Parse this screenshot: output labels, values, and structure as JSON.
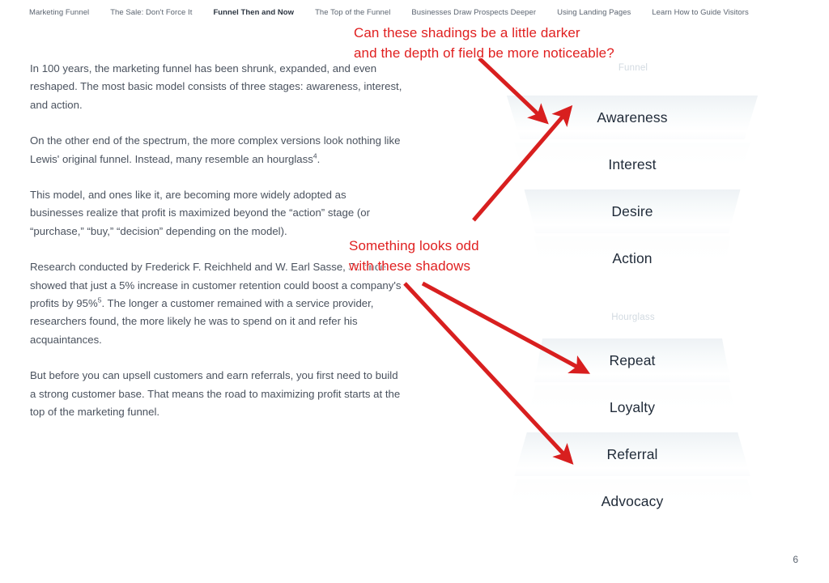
{
  "topnav": {
    "items": [
      {
        "label": "Marketing Funnel",
        "active": false
      },
      {
        "label": "The Sale: Don't Force It",
        "active": false
      },
      {
        "label": "Funnel Then and Now",
        "active": true
      },
      {
        "label": "The Top of the Funnel",
        "active": false
      },
      {
        "label": "Businesses Draw Prospects Deeper",
        "active": false
      },
      {
        "label": "Using Landing Pages",
        "active": false
      },
      {
        "label": "Learn How to Guide Visitors",
        "active": false
      }
    ]
  },
  "article": {
    "paragraphs": [
      "In 100 years, the marketing funnel has been shrunk, expanded, and even reshaped. The most basic model consists of three stages: awareness, interest, and action.",
      "On the other end of the spectrum, the more complex versions look nothing like Lewis' original funnel. Instead, many resemble an hourglass",
      "This model, and ones like it, are becoming more widely adopted as businesses realize that profit is maximized beyond the “action” stage (or “purchase,” “buy,” “decision” depending on the model).",
      "Research conducted by Frederick F. Reichheld and W. Earl Sasse, Jr. once showed that just a 5% increase in customer retention could boost a company's profits by 95%",
      "But before you can upsell customers and earn referrals, you first need to build a strong customer base. That means the road to maximizing profit starts at the top of the marketing funnel."
    ],
    "footnote_marks": {
      "hourglass": "4",
      "profits": "5"
    },
    "paragraph_tails": {
      "hourglass": ".",
      "profits": ". The longer a customer remained with a service provider, researchers found, the more likely he was to spend on it and refer his acquaintances."
    }
  },
  "diagram": {
    "funnel": {
      "label": "Funnel",
      "stages": [
        {
          "label": "Awareness",
          "tone": "shaded"
        },
        {
          "label": "Interest",
          "tone": "light"
        },
        {
          "label": "Desire",
          "tone": "shaded"
        },
        {
          "label": "Action",
          "tone": "light"
        }
      ]
    },
    "hourglass": {
      "label": "Hourglass",
      "stages": [
        {
          "label": "Repeat",
          "tone": "shaded"
        },
        {
          "label": "Loyalty",
          "tone": "light"
        },
        {
          "label": "Referral",
          "tone": "shaded"
        },
        {
          "label": "Advocacy",
          "tone": "light"
        }
      ]
    }
  },
  "annotations": [
    {
      "id": "shadings",
      "text": "Can these shadings be a little darker\nand the depth of field be more noticeable?"
    },
    {
      "id": "shadows",
      "text": "Something looks odd\nwith these shadows"
    }
  ],
  "page_number": "6",
  "colors": {
    "annotation_red": "#e02020",
    "body_text": "#4a525e",
    "stage_text": "#1f2a38",
    "group_label": "#d2dae1",
    "nav_text": "#5b6470"
  }
}
